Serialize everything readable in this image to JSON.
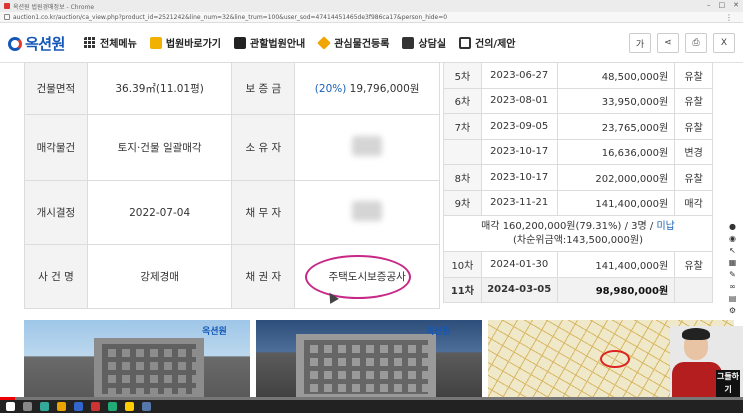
{
  "browser": {
    "tab_title": "옥션원 법원경매정보 - Chrome",
    "url": "auction1.co.kr/auction/ca_view.php?product_id=2521242&line_num=32&line_trum=100&user_sod=47414451465de3f986ca17&person_hide=0"
  },
  "header": {
    "logo_text": "옥션원",
    "nav": [
      {
        "label": "전체메뉴",
        "icon": "grid-icon"
      },
      {
        "label": "법원바로가기",
        "icon": "court-icon"
      },
      {
        "label": "관할법원안내",
        "icon": "book-icon"
      },
      {
        "label": "관심물건등록",
        "icon": "heart-icon"
      },
      {
        "label": "상담실",
        "icon": "truck-icon"
      },
      {
        "label": "건의/제안",
        "icon": "headset-icon"
      }
    ],
    "tools": [
      "가",
      "share",
      "print",
      "X"
    ]
  },
  "left_table": {
    "building_area_label": "건물면적",
    "building_area_value": "36.39㎡(11.01평)",
    "deposit_label": "보 증 금",
    "deposit_pct": "(20%)",
    "deposit_value": "19,796,000원",
    "sale_item_label": "매각물건",
    "sale_item_value": "토지·건물 일괄매각",
    "owner_label": "소 유 자",
    "decision_label": "개시결정",
    "decision_value": "2022-07-04",
    "debtor_label": "채 무 자",
    "case_name_label": "사 건 명",
    "case_name_value": "강제경매",
    "creditor_label": "채 권 자",
    "creditor_value": "주택도시보증공사"
  },
  "bid_history": {
    "rows": [
      {
        "no": "5차",
        "date": "2023-06-27",
        "amount": "48,500,000원",
        "result": "유찰"
      },
      {
        "no": "6차",
        "date": "2023-08-01",
        "amount": "33,950,000원",
        "result": "유찰"
      },
      {
        "no": "7차",
        "date": "2023-09-05",
        "amount": "23,765,000원",
        "result": "유찰"
      },
      {
        "no": "",
        "date": "2023-10-17",
        "amount": "16,636,000원",
        "result": "변경"
      },
      {
        "no": "8차",
        "date": "2023-10-17",
        "amount": "202,000,000원",
        "result": "유찰"
      },
      {
        "no": "9차",
        "date": "2023-11-21",
        "amount": "141,400,000원",
        "result": "매각"
      }
    ],
    "summary_line1_prefix": "매각 160,200,000원(79.31%) / 3명 / ",
    "summary_line1_status": "미납",
    "summary_line2": "(차순위금액:143,500,000원)",
    "row10": {
      "no": "10차",
      "date": "2024-01-30",
      "amount": "141,400,000원",
      "result": "유찰"
    },
    "row11": {
      "no": "11차",
      "date": "2024-03-05",
      "amount": "98,980,000원",
      "result": ""
    }
  },
  "photos": {
    "logo": "옥션원"
  },
  "webcam": {
    "badge": "그들하기"
  },
  "video": {
    "progress": 0.02
  }
}
